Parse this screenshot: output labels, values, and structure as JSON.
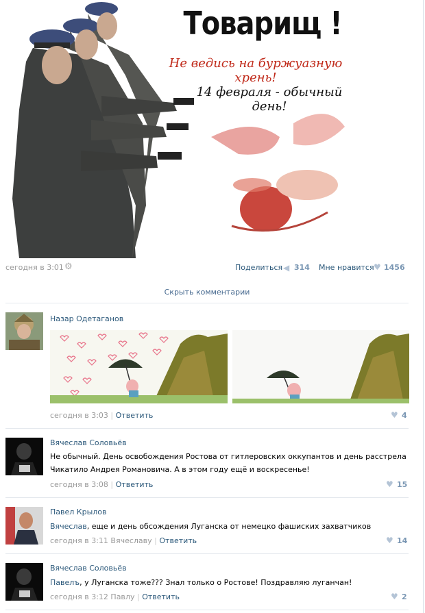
{
  "poster": {
    "title": "Товарищ !",
    "line1": "Не ведись на буржуазную хрень!",
    "line2": "14 февраля - обычный день!"
  },
  "post": {
    "date": "сегодня в 3:01",
    "share_label": "Поделиться",
    "share_count": "314",
    "like_label": "Мне нравится",
    "like_count": "1456"
  },
  "hide_comments": "Скрыть комментарии",
  "comments": [
    {
      "author": "Назар Одетаганов",
      "text": "",
      "date": "сегодня в 3:03",
      "reply_to": "",
      "reply": "Ответить",
      "likes": "4"
    },
    {
      "author": "Вячеслав Соловьёв",
      "text_line1": "Не обычный. День освобождения Ростова от гитлеровских оккупантов и день расстрела",
      "text_line2": "Чикатило Андрея Романовича. А в этом году ещё и воскресенье!",
      "date": "сегодня в 3:08",
      "reply": "Ответить",
      "likes": "15"
    },
    {
      "author": "Павел Крылов",
      "mention": "Вячеслав",
      "text": ", еще и день обсождения Луганска от немецко фашиских захватчиков",
      "date": "сегодня в 3:11",
      "reply_to": "Вячеславу",
      "reply": "Ответить",
      "likes": "14"
    },
    {
      "author": "Вячеслав Соловьёв",
      "mention": "Павелъ",
      "text": ", у Луганска тоже??? Знал только о Ростове! Поздравляю луганчан!",
      "date": "сегодня в 3:12",
      "reply_to": "Павлу",
      "reply": "Ответить",
      "likes": "2"
    }
  ],
  "icons": {
    "settings": "gear-icon",
    "share": "megaphone-icon",
    "like": "heart-icon"
  },
  "colors": {
    "link": "#2b587a",
    "meta": "#999999",
    "count": "#7996b3",
    "poster_red": "#c02a1a"
  }
}
